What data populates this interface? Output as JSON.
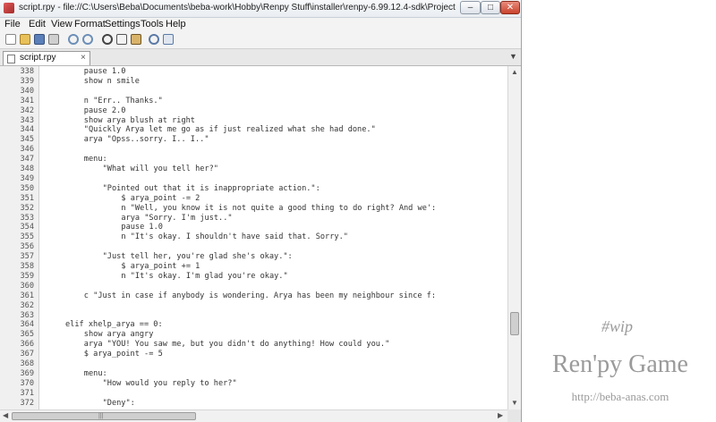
{
  "window": {
    "title": "script.rpy - file://C:\\Users\\Beba\\Documents\\beba-work\\Hobby\\Renpy Stuff\\installer\\renpy-6.99.12.4-sdk\\Project-Zombie\\game\\script...",
    "min_glyph": "–",
    "max_glyph": "□",
    "close_glyph": "✕"
  },
  "menubar": [
    "File",
    "Edit",
    "View",
    "Format",
    "Settings",
    "Tools",
    "Help"
  ],
  "toolbar_icons": [
    "new-file-icon",
    "open-folder-icon",
    "save-icon",
    "print-icon",
    "undo-icon",
    "redo-icon",
    "cut-icon",
    "copy-icon",
    "paste-icon",
    "find-icon",
    "replace-icon"
  ],
  "tabs": [
    {
      "label": "script.rpy",
      "close": "×"
    }
  ],
  "tab_list_arrow": "▼",
  "scroll_glyphs": {
    "up": "▲",
    "down": "▼",
    "left": "◀",
    "right": "▶",
    "grip": "|||"
  },
  "lines": [
    {
      "num": "338",
      "indent": 16,
      "text": "pause 1.0"
    },
    {
      "num": "339",
      "indent": 16,
      "text": "show n smile"
    },
    {
      "num": "340",
      "indent": 0,
      "text": ""
    },
    {
      "num": "341",
      "indent": 16,
      "text": "n \"Err.. Thanks.\""
    },
    {
      "num": "342",
      "indent": 16,
      "text": "pause 2.0"
    },
    {
      "num": "343",
      "indent": 16,
      "text": "show arya blush at right"
    },
    {
      "num": "344",
      "indent": 16,
      "text": "\"Quickly Arya let me go as if just realized what she had done.\""
    },
    {
      "num": "345",
      "indent": 16,
      "text": "arya \"Opss..sorry. I.. I..\""
    },
    {
      "num": "346",
      "indent": 0,
      "text": ""
    },
    {
      "num": "347",
      "indent": 16,
      "text": "menu:"
    },
    {
      "num": "348",
      "indent": 20,
      "text": "\"What will you tell her?\""
    },
    {
      "num": "349",
      "indent": 0,
      "text": ""
    },
    {
      "num": "350",
      "indent": 20,
      "text": "\"Pointed out that it is inappropriate action.\":"
    },
    {
      "num": "351",
      "indent": 24,
      "text": "$ arya_point -= 2"
    },
    {
      "num": "352",
      "indent": 24,
      "text": "n \"Well, you know it is not quite a good thing to do right? And we':"
    },
    {
      "num": "353",
      "indent": 24,
      "text": "arya \"Sorry. I'm just..\""
    },
    {
      "num": "354",
      "indent": 24,
      "text": "pause 1.0"
    },
    {
      "num": "355",
      "indent": 24,
      "text": "n \"It's okay. I shouldn't have said that. Sorry.\""
    },
    {
      "num": "356",
      "indent": 0,
      "text": ""
    },
    {
      "num": "357",
      "indent": 20,
      "text": "\"Just tell her, you're glad she's okay.\":"
    },
    {
      "num": "358",
      "indent": 24,
      "text": "$ arya_point += 1"
    },
    {
      "num": "359",
      "indent": 24,
      "text": "n \"It's okay. I'm glad you're okay.\""
    },
    {
      "num": "360",
      "indent": 0,
      "text": ""
    },
    {
      "num": "361",
      "indent": 16,
      "text": "c \"Just in case if anybody is wondering. Arya has been my neighbour since f:"
    },
    {
      "num": "362",
      "indent": 0,
      "text": ""
    },
    {
      "num": "363",
      "indent": 0,
      "text": ""
    },
    {
      "num": "364",
      "indent": 12,
      "text": "elif xhelp_arya == 0:"
    },
    {
      "num": "365",
      "indent": 16,
      "text": "show arya angry"
    },
    {
      "num": "366",
      "indent": 16,
      "text": "arya \"YOU! You saw me, but you didn't do anything! How could you.\""
    },
    {
      "num": "367",
      "indent": 16,
      "text": "$ arya_point -= 5"
    },
    {
      "num": "368",
      "indent": 0,
      "text": ""
    },
    {
      "num": "369",
      "indent": 16,
      "text": "menu:"
    },
    {
      "num": "370",
      "indent": 20,
      "text": "\"How would you reply to her?\""
    },
    {
      "num": "371",
      "indent": 0,
      "text": ""
    },
    {
      "num": "372",
      "indent": 20,
      "text": "\"Deny\":"
    }
  ],
  "watermark": {
    "tag": "#wip",
    "title": "Ren'py Game",
    "url": "http://beba-anas.com"
  }
}
